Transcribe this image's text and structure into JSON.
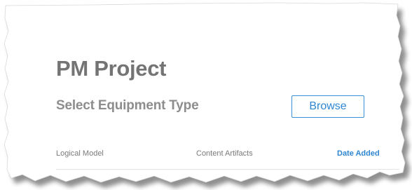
{
  "header": {
    "title": "PM Project",
    "subtitle": "Select Equipment Type"
  },
  "actions": {
    "browse_label": "Browse"
  },
  "table": {
    "columns": [
      "Logical Model",
      "Content Artifacts",
      "Date Added"
    ]
  },
  "colors": {
    "accent": "#2f86d0",
    "title": "#747474",
    "subtitle": "#8d8d8d",
    "muted_text": "#7a7a7a",
    "divider": "#e4e4e4",
    "shadow": "#6a6a6a"
  }
}
